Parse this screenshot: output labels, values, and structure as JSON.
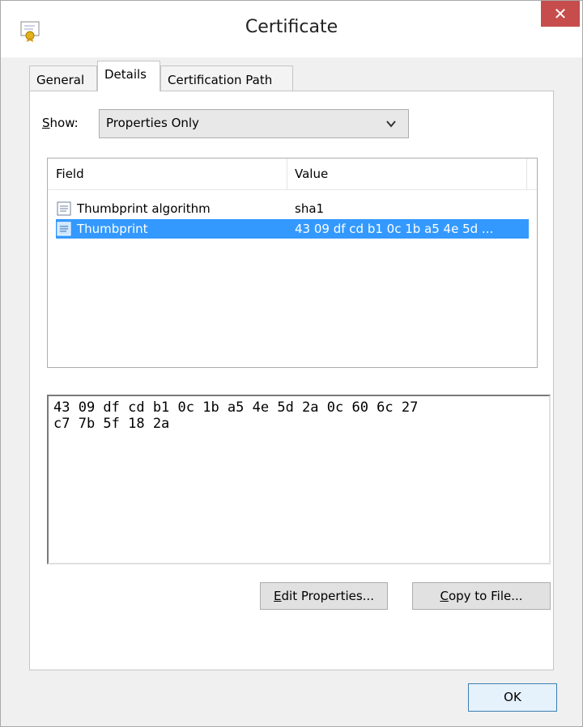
{
  "window": {
    "title": "Certificate"
  },
  "tabs": [
    {
      "label": "General"
    },
    {
      "label": "Details",
      "active": true
    },
    {
      "label": "Certification Path"
    }
  ],
  "show": {
    "label_underlined": "S",
    "label_rest": "how:",
    "selected": "Properties Only"
  },
  "list": {
    "columns": {
      "field": "Field",
      "value": "Value"
    },
    "rows": [
      {
        "field": "Thumbprint algorithm",
        "value": "sha1",
        "selected": false
      },
      {
        "field": "Thumbprint",
        "value": "43 09 df cd b1 0c 1b a5 4e 5d ...",
        "selected": true
      }
    ]
  },
  "detail": {
    "text": "43 09 df cd b1 0c 1b a5 4e 5d 2a 0c 60 6c 27\nc7 7b 5f 18 2a"
  },
  "buttons": {
    "edit_underlined": "E",
    "edit_rest": "dit Properties...",
    "copy_underlined": "C",
    "copy_rest": "opy to File...",
    "ok": "OK"
  },
  "colors": {
    "selection": "#3399ff",
    "close": "#c74d4d"
  }
}
